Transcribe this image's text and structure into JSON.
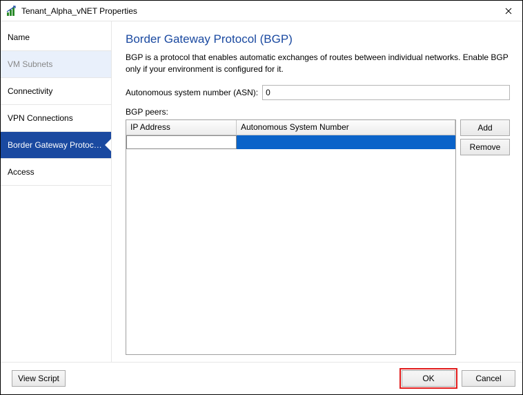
{
  "window": {
    "title": "Tenant_Alpha_vNET Properties"
  },
  "sidebar": {
    "header": "Name",
    "items": [
      {
        "label": "VM Subnets",
        "state": "dim"
      },
      {
        "label": "Connectivity",
        "state": ""
      },
      {
        "label": "VPN Connections",
        "state": ""
      },
      {
        "label": "Border Gateway Protocol...",
        "state": "active"
      },
      {
        "label": "Access",
        "state": ""
      }
    ]
  },
  "page": {
    "title": "Border Gateway Protocol (BGP)",
    "description": "BGP is a protocol that enables automatic exchanges of routes between individual networks. Enable BGP only if your environment is configured for it.",
    "asn_label": "Autonomous system number (ASN):",
    "asn_value": "0",
    "peers_label": "BGP peers:",
    "columns": {
      "ip": "IP Address",
      "asn": "Autonomous System Number"
    },
    "peers": [
      {
        "ip": "",
        "asn": ""
      }
    ],
    "buttons": {
      "add": "Add",
      "remove": "Remove"
    }
  },
  "footer": {
    "view_script": "View Script",
    "ok": "OK",
    "cancel": "Cancel"
  }
}
